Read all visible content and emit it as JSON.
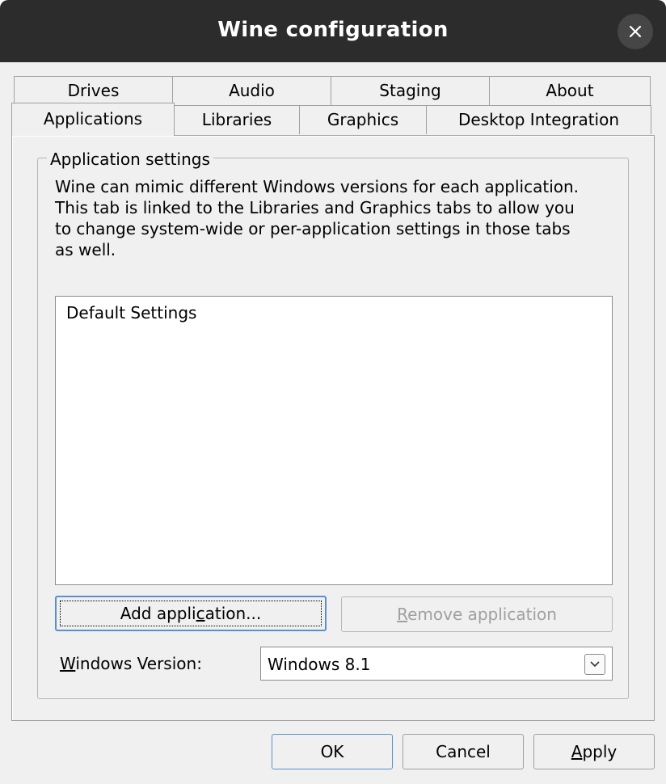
{
  "window": {
    "title": "Wine configuration",
    "close_icon": "close-icon"
  },
  "tabs": {
    "row_back": [
      "Drives",
      "Audio",
      "Staging",
      "About"
    ],
    "row_front": [
      "Applications",
      "Libraries",
      "Graphics",
      "Desktop Integration"
    ],
    "selected": "Applications"
  },
  "app_settings": {
    "group_title": "Application settings",
    "description": "Wine can mimic different Windows versions for each application. This tab is linked to the Libraries and Graphics tabs to allow you to change system-wide or per-application settings in those tabs as well.",
    "desc_lines": [
      "Wine can mimic different Windows versions for each application.",
      "This tab is linked to the Libraries and Graphics tabs to allow you",
      "to change system-wide or per-application settings in those tabs",
      "as well."
    ],
    "list_items": [
      "Default Settings"
    ],
    "add_button": {
      "pre": "Add appli",
      "mnemonic": "c",
      "post": "ation..."
    },
    "remove_button": {
      "pre": "",
      "mnemonic": "R",
      "post": "emove application"
    }
  },
  "windows_version": {
    "label_mnemonic": "W",
    "label_rest": "indows Version:",
    "value": "Windows 8.1",
    "dropdown_icon": "chevron-down-icon"
  },
  "footer": {
    "ok_label": "OK",
    "cancel_label": "Cancel",
    "apply_mnemonic": "A",
    "apply_rest": "pply"
  },
  "colors": {
    "titlebar": "#2c2c2c",
    "dialog_bg": "#f0f0f0",
    "focus_blue": "#5a8fd0",
    "disabled_text": "#a0a0a0"
  }
}
